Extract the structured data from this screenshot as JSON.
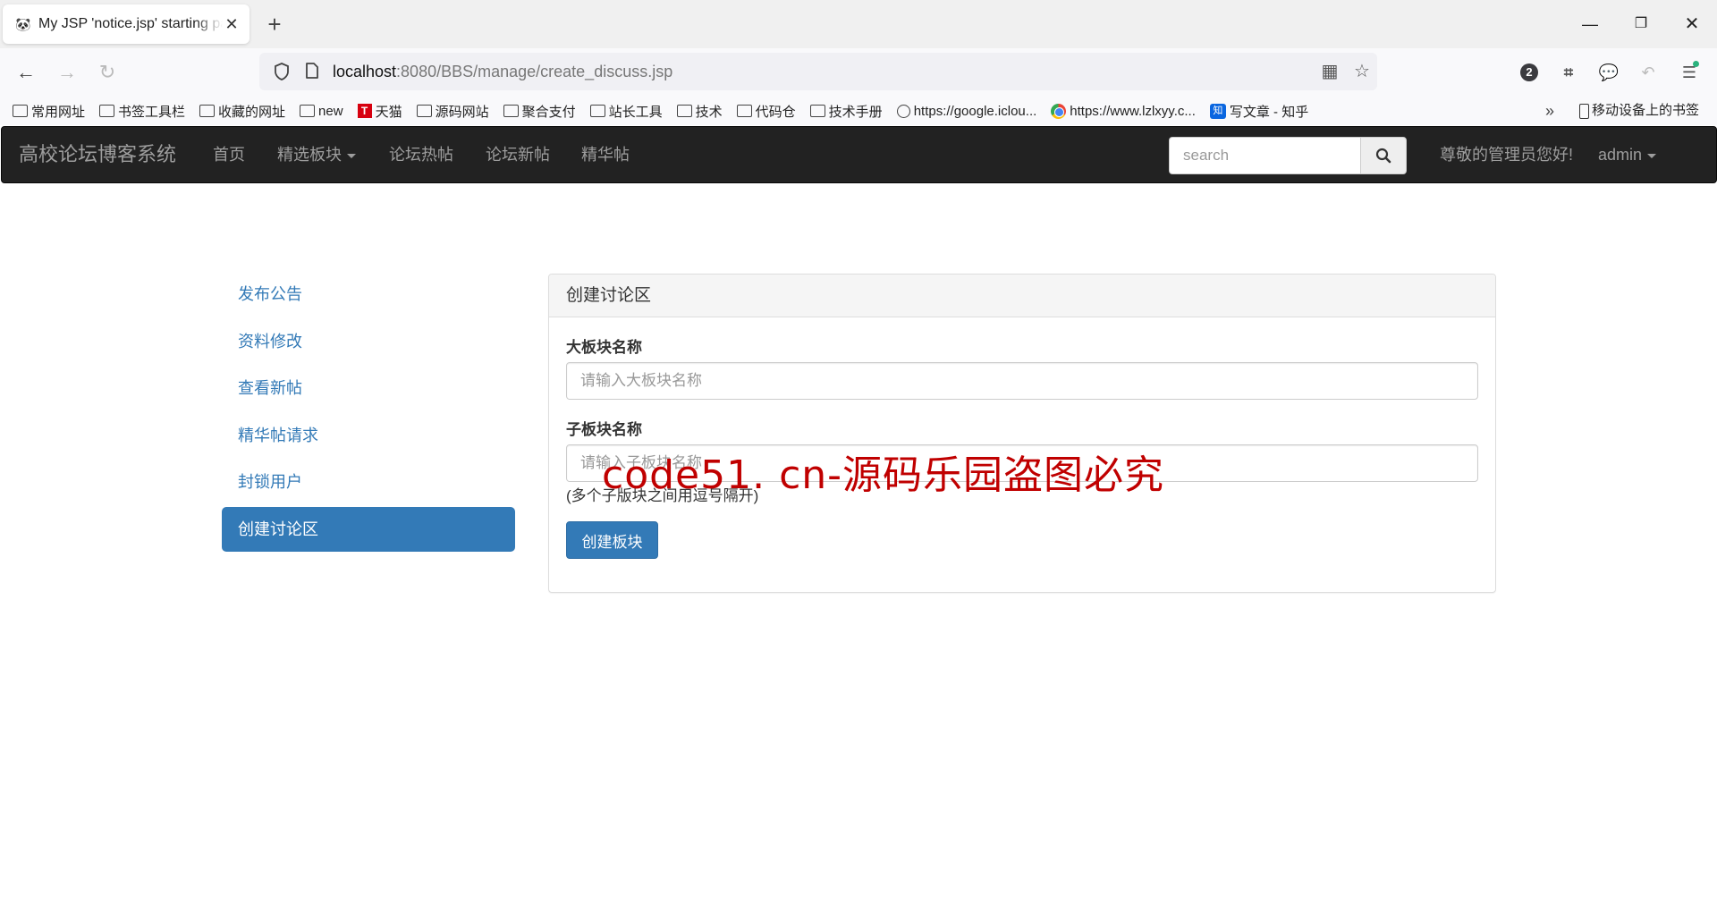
{
  "browser": {
    "tab_title": "My JSP 'notice.jsp' starting page",
    "new_tab_label": "+",
    "url_host": "localhost",
    "url_rest": ":8080/BBS/manage/create_discuss.jsp",
    "extension_badge_count": "2",
    "bookmarks": [
      {
        "label": "常用网址",
        "icon": "folder-icon"
      },
      {
        "label": "书签工具栏",
        "icon": "folder-icon"
      },
      {
        "label": "收藏的网址",
        "icon": "folder-icon"
      },
      {
        "label": "new",
        "icon": "folder-icon"
      },
      {
        "label": "天猫",
        "icon": "tmall-icon"
      },
      {
        "label": "源码网站",
        "icon": "folder-icon"
      },
      {
        "label": "聚合支付",
        "icon": "folder-icon"
      },
      {
        "label": "站长工具",
        "icon": "folder-icon"
      },
      {
        "label": "技术",
        "icon": "folder-icon"
      },
      {
        "label": "代码仓",
        "icon": "folder-icon"
      },
      {
        "label": "技术手册",
        "icon": "folder-icon"
      },
      {
        "label": "https://google.iclou...",
        "icon": "globe-icon"
      },
      {
        "label": "https://www.lzlxyy.c...",
        "icon": "chrome-icon"
      },
      {
        "label": "写文章 - 知乎",
        "icon": "zhihu-icon"
      }
    ],
    "mobile_bookmarks": "移动设备上的书签"
  },
  "navbar": {
    "brand": "高校论坛博客系统",
    "links": [
      "首页",
      "精选板块",
      "论坛热帖",
      "论坛新帖",
      "精华帖"
    ],
    "search_placeholder": "search",
    "greeting": "尊敬的管理员您好!",
    "user": "admin"
  },
  "sidebar": {
    "items": [
      {
        "label": "发布公告",
        "active": false
      },
      {
        "label": "资料修改",
        "active": false
      },
      {
        "label": "查看新帖",
        "active": false
      },
      {
        "label": "精华帖请求",
        "active": false
      },
      {
        "label": "封锁用户",
        "active": false
      },
      {
        "label": "创建讨论区",
        "active": true
      }
    ]
  },
  "panel": {
    "title": "创建讨论区",
    "field1_label": "大板块名称",
    "field1_placeholder": "请输入大板块名称",
    "field1_value": "",
    "field2_label": "子板块名称",
    "field2_placeholder": "请输入子板块名称",
    "field2_value": "",
    "help_text": "(多个子版块之间用逗号隔开)",
    "submit_label": "创建板块"
  },
  "watermark": "code51. cn-源码乐园盗图必究",
  "colors": {
    "primary": "#337ab7",
    "navbar_bg": "#222222",
    "watermark": "#c00000"
  }
}
